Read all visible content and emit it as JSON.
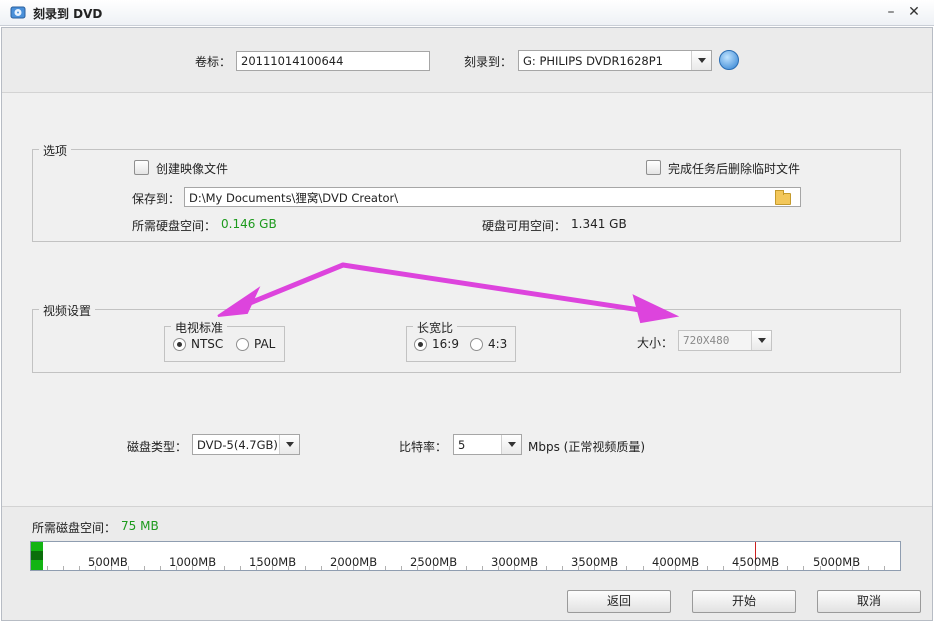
{
  "window": {
    "title": "刻录到 DVD"
  },
  "header": {
    "volume_label": "卷标：",
    "volume_value": "20111014100644",
    "burn_to_label": "刻录到：",
    "burn_to_value": "G: PHILIPS  DVDR1628P1"
  },
  "options": {
    "group_title": "选项",
    "create_image_label": "创建映像文件",
    "create_image_checked": false,
    "delete_temp_label": "完成任务后删除临时文件",
    "delete_temp_checked": false,
    "save_to_label": "保存到：",
    "save_to_value": "D:\\My Documents\\狸窝\\DVD Creator\\",
    "required_space_label": "所需硬盘空间：",
    "required_space_value": "0.146 GB",
    "available_space_label": "硬盘可用空间：",
    "available_space_value": "1.341 GB"
  },
  "video": {
    "group_title": "视频设置",
    "tv_standard_label": "电视标准",
    "tv_standard_options": [
      "NTSC",
      "PAL"
    ],
    "tv_standard_selected": "NTSC",
    "aspect_label": "长宽比",
    "aspect_options": [
      "16:9",
      "4:3"
    ],
    "aspect_selected": "16:9",
    "size_label": "大小：",
    "size_value": "720X480"
  },
  "disc": {
    "type_label": "磁盘类型：",
    "type_value": "DVD-5(4.7GB)",
    "bitrate_label": "比特率：",
    "bitrate_value": "5",
    "bitrate_unit": "Mbps (正常视频质量)"
  },
  "usage": {
    "label": "所需磁盘空间：",
    "value": "75 MB",
    "used_mb": 75,
    "capacity_mb": 5400,
    "limit_mb": 4500,
    "tick_labels": [
      "500MB",
      "1000MB",
      "1500MB",
      "2000MB",
      "2500MB",
      "3000MB",
      "3500MB",
      "4000MB",
      "4500MB",
      "5000MB"
    ]
  },
  "buttons": {
    "back": "返回",
    "start": "开始",
    "cancel": "取消"
  },
  "colors": {
    "annotation_arrow": "#dd44dd",
    "space_value": "#1c9a1c",
    "usage_fill": "#13b413"
  }
}
